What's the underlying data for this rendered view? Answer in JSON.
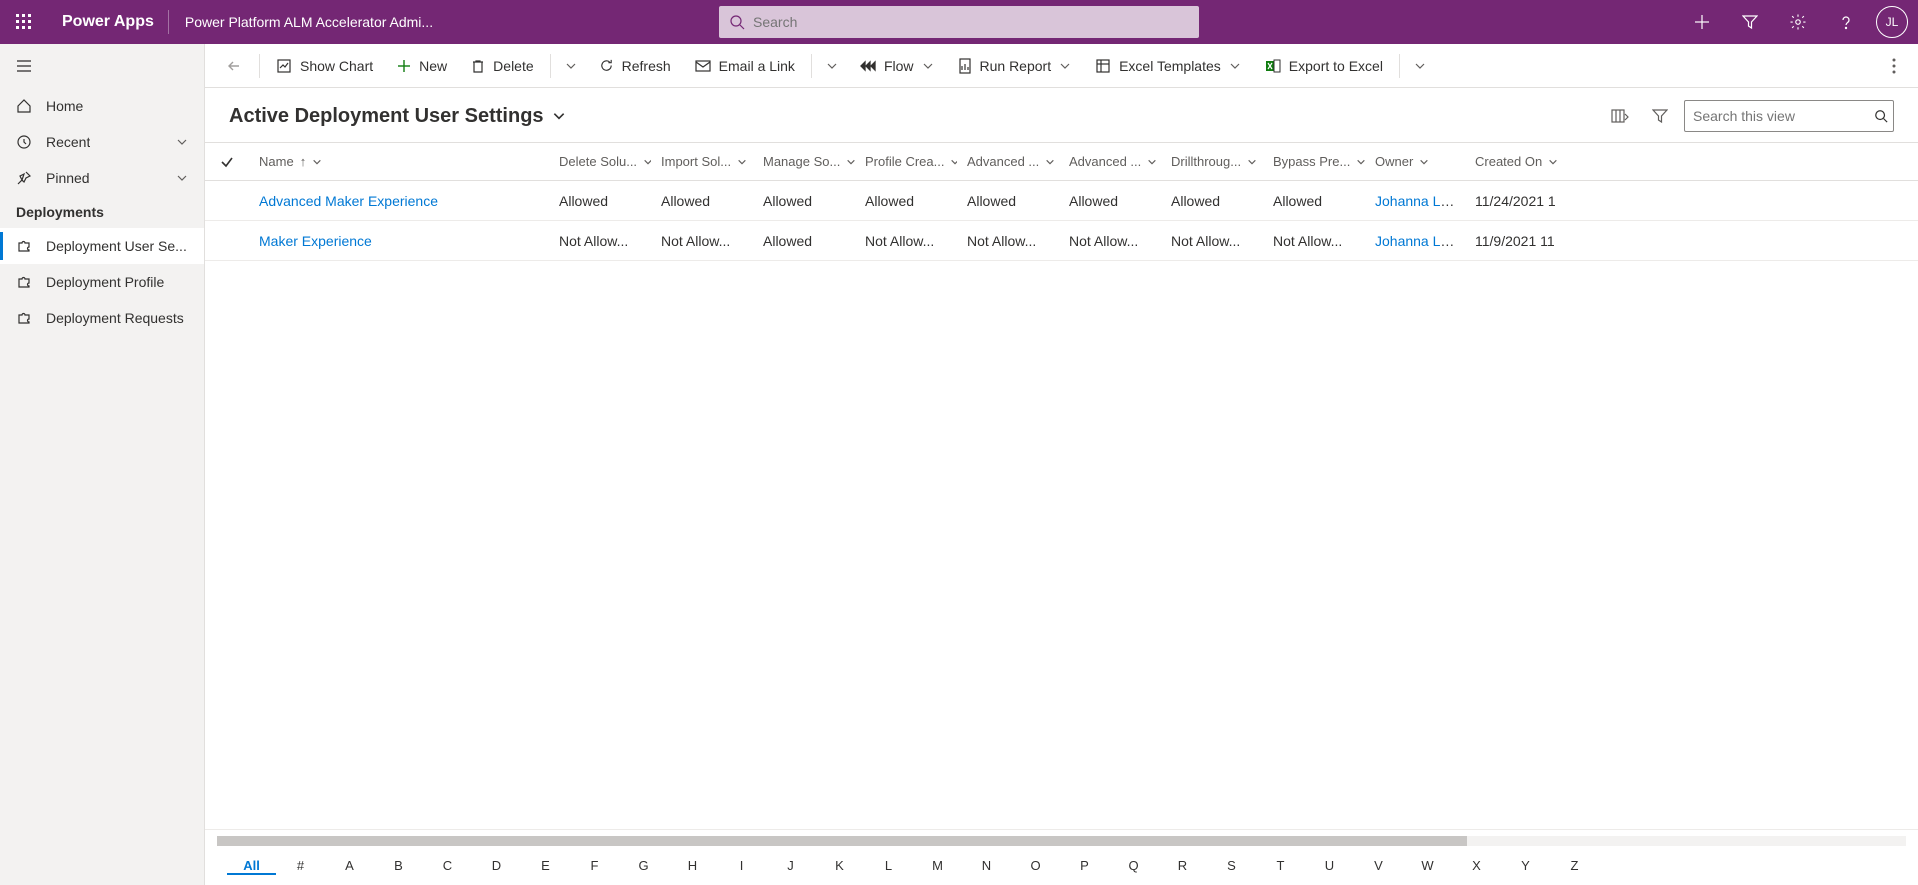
{
  "header": {
    "app_name": "Power Apps",
    "breadcrumb": "Power Platform ALM Accelerator Admi...",
    "search_placeholder": "Search",
    "avatar_initials": "JL"
  },
  "sidebar": {
    "items": {
      "home": "Home",
      "recent": "Recent",
      "pinned": "Pinned"
    },
    "section": "Deployments",
    "sub": {
      "user_settings": "Deployment User Se...",
      "profile": "Deployment Profile",
      "requests": "Deployment Requests"
    }
  },
  "commands": {
    "show_chart": "Show Chart",
    "new": "New",
    "delete": "Delete",
    "refresh": "Refresh",
    "email": "Email a Link",
    "flow": "Flow",
    "run_report": "Run Report",
    "excel_templates": "Excel Templates",
    "export_excel": "Export to Excel"
  },
  "view": {
    "title": "Active Deployment User Settings",
    "search_placeholder": "Search this view"
  },
  "columns": {
    "name": "Name",
    "delete_solution": "Delete Solu...",
    "import_solution": "Import Sol...",
    "manage_solution": "Manage So...",
    "profile_creation": "Profile Crea...",
    "advanced1": "Advanced ...",
    "advanced2": "Advanced ...",
    "drillthrough": "Drillthroug...",
    "bypass": "Bypass Pre...",
    "owner": "Owner",
    "created_on": "Created On"
  },
  "rows": [
    {
      "name": "Advanced Maker Experience",
      "delete_solution": "Allowed",
      "import_solution": "Allowed",
      "manage_solution": "Allowed",
      "profile_creation": "Allowed",
      "advanced1": "Allowed",
      "advanced2": "Allowed",
      "drillthrough": "Allowed",
      "bypass": "Allowed",
      "owner": "Johanna Loren",
      "created_on": "11/24/2021 1"
    },
    {
      "name": "Maker Experience",
      "delete_solution": "Not Allow...",
      "import_solution": "Not Allow...",
      "manage_solution": "Allowed",
      "profile_creation": "Not Allow...",
      "advanced1": "Not Allow...",
      "advanced2": "Not Allow...",
      "drillthrough": "Not Allow...",
      "bypass": "Not Allow...",
      "owner": "Johanna Loren",
      "created_on": "11/9/2021 11"
    }
  ],
  "index": [
    "All",
    "#",
    "A",
    "B",
    "C",
    "D",
    "E",
    "F",
    "G",
    "H",
    "I",
    "J",
    "K",
    "L",
    "M",
    "N",
    "O",
    "P",
    "Q",
    "R",
    "S",
    "T",
    "U",
    "V",
    "W",
    "X",
    "Y",
    "Z"
  ]
}
